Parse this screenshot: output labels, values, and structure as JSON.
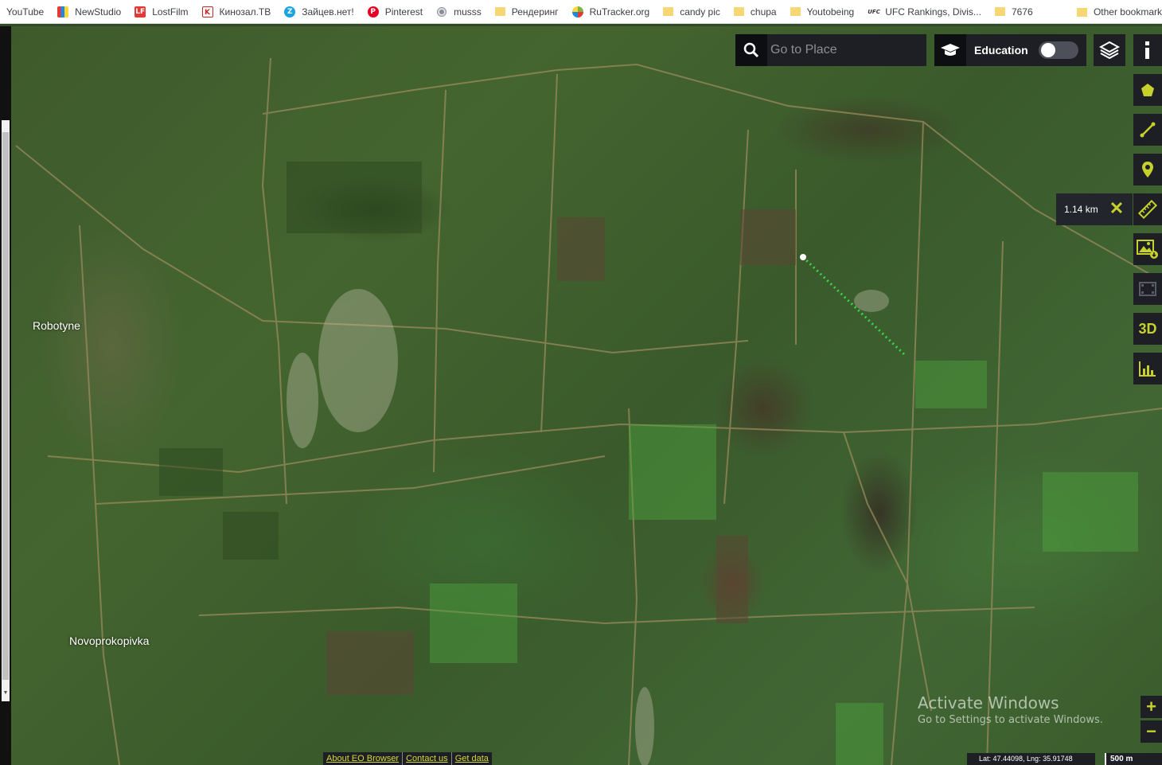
{
  "bookmarks": {
    "items": [
      {
        "label": "YouTube",
        "icon": "youtube-icon",
        "color": "#ffffff"
      },
      {
        "label": "NewStudio",
        "icon": "newstudio-icon",
        "color": "#7a3fbf"
      },
      {
        "label": "LostFilm",
        "icon": "lostfilm-icon",
        "color": "#e53935"
      },
      {
        "label": "Кинозал.ТВ",
        "icon": "kinozal-icon",
        "color": "#c62828"
      },
      {
        "label": "Зайцев.нет!",
        "icon": "zaycev-icon",
        "color": "#1aa3e0"
      },
      {
        "label": "Pinterest",
        "icon": "pinterest-icon",
        "color": "#e60023"
      },
      {
        "label": "musss",
        "icon": "musss-icon",
        "color": "#8a8f99"
      },
      {
        "label": "Рендеринг",
        "icon": "folder-icon",
        "color": "#f7d774"
      },
      {
        "label": "RuTracker.org",
        "icon": "rutracker-icon",
        "color": "#7cb342"
      },
      {
        "label": "candy pic",
        "icon": "folder-icon",
        "color": "#f7d774"
      },
      {
        "label": "chupa",
        "icon": "folder-icon",
        "color": "#f7d774"
      },
      {
        "label": "Youtobeing",
        "icon": "folder-icon",
        "color": "#f7d774"
      },
      {
        "label": "UFC Rankings, Divis...",
        "icon": "ufc-icon",
        "color": "#333333"
      },
      {
        "label": "7676",
        "icon": "folder-icon",
        "color": "#f7d774"
      }
    ],
    "other": "Other bookmarks"
  },
  "map": {
    "labels": {
      "robotyne": "Robotyne",
      "novoprokopivka": "Novoprokopivka"
    }
  },
  "search": {
    "placeholder": "Go to Place"
  },
  "education": {
    "label": "Education",
    "enabled": false
  },
  "measure": {
    "value": "1.14 km"
  },
  "tools": {
    "three_d": "3D"
  },
  "zoom": {
    "in": "+",
    "out": "−"
  },
  "watermark": {
    "title": "Activate Windows",
    "subtitle": "Go to Settings to activate Windows."
  },
  "footer": {
    "links": [
      "About EO Browser",
      "Contact us",
      "Get data"
    ],
    "coords": "Lat: 47.44098, Lng: 35.91748",
    "scale": "500 m"
  },
  "colors": {
    "accent": "#c6d12c",
    "panel": "#1d1f24"
  }
}
